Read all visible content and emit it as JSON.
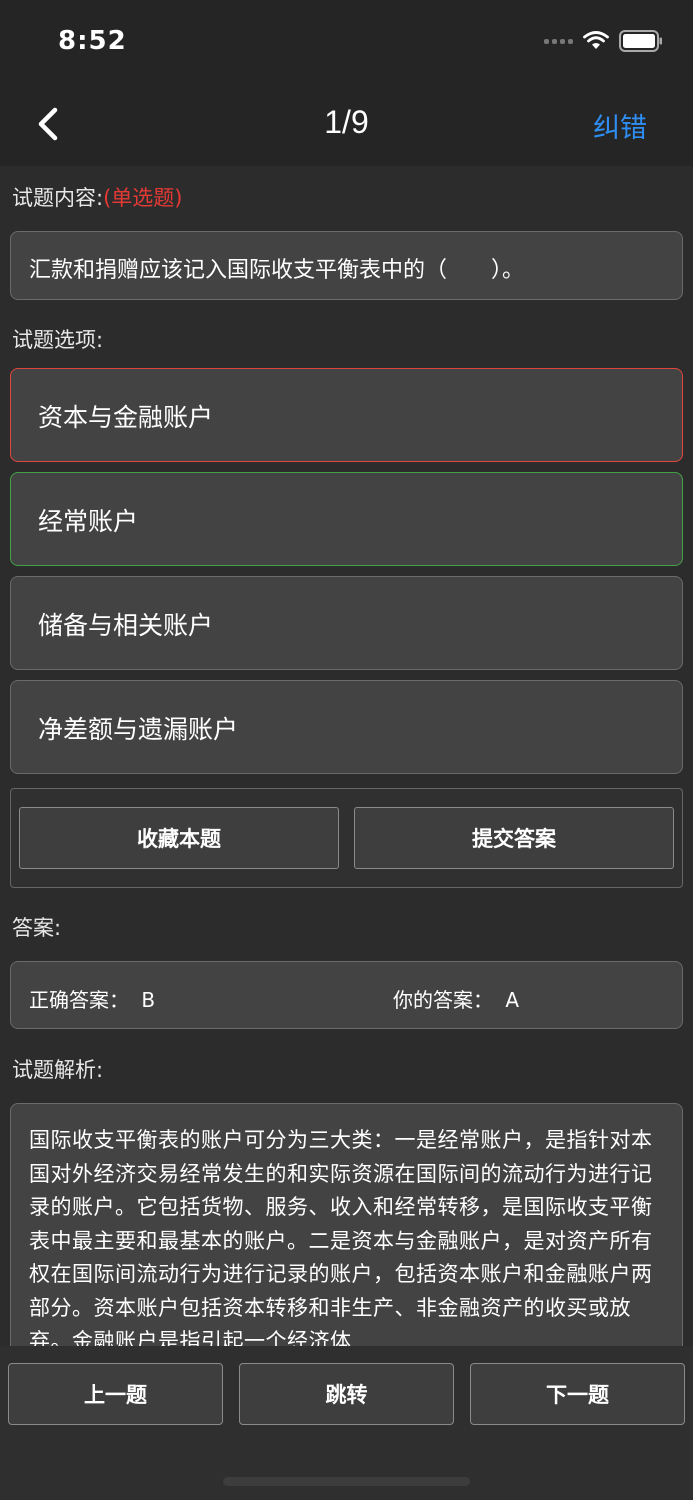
{
  "status_bar": {
    "time": "8:52"
  },
  "nav": {
    "title": "1/9",
    "right_action": "纠错"
  },
  "question": {
    "section_label": "试题内容:",
    "type_tag": "(单选题)",
    "text": "汇款和捐赠应该记入国际收支平衡表中的（　　）。"
  },
  "options": {
    "section_label": "试题选项:",
    "items": [
      {
        "label": "资本与金融账户",
        "state": "wrong"
      },
      {
        "label": "经常账户",
        "state": "correct"
      },
      {
        "label": "储备与相关账户",
        "state": "none"
      },
      {
        "label": "净差额与遗漏账户",
        "state": "none"
      }
    ]
  },
  "actions": {
    "favorite": "收藏本题",
    "submit": "提交答案"
  },
  "answer": {
    "section_label": "答案:",
    "correct_label": "正确答案：",
    "correct_value": "B",
    "yours_label": "你的答案：",
    "yours_value": "A"
  },
  "analysis": {
    "section_label": "试题解析:",
    "text": "国际收支平衡表的账户可分为三大类：一是经常账户，是指针对本国对外经济交易经常发生的和实际资源在国际间的流动行为进行记录的账户。它包括货物、服务、收入和经常转移，是国际收支平衡表中最主要和最基本的账户。二是资本与金融账户，是对资产所有权在国际间流动行为进行记录的账户，包括资本账户和金融账户两部分。资本账户包括资本转移和非生产、非金融资产的收买或放弃。金融账户是指引起一个经济体"
  },
  "bottom": {
    "prev": "上一题",
    "jump": "跳转",
    "next": "下一题"
  },
  "colors": {
    "accent": "#2f8ef4",
    "wrong": "#e0473c",
    "correct": "#43a047",
    "tag": "#e53935"
  }
}
